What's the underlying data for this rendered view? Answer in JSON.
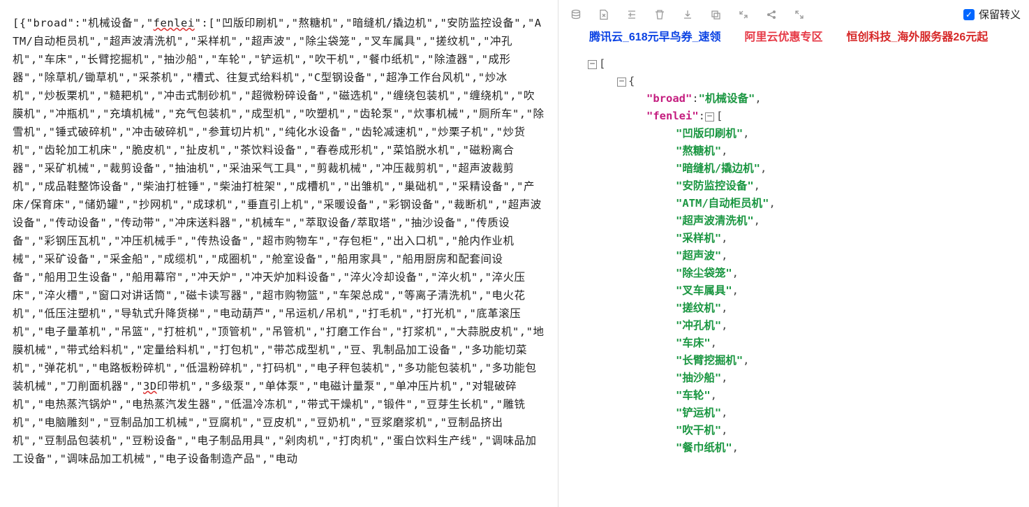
{
  "left_raw": "[{\"broad\":\"机械设备\",\"fenlei\":[\"凹版印刷机\",\"熬糖机\",\"暗缝机/撬边机\",\"安防监控设备\",\"ATM/自动柜员机\",\"超声波清洗机\",\"采样机\",\"超声波\",\"除尘袋笼\",\"叉车属具\",\"搓纹机\",\"冲孔机\",\"车床\",\"长臂挖掘机\",\"抽沙船\",\"车轮\",\"铲运机\",\"吹干机\",\"餐巾纸机\",\"除渣器\",\"成形器\",\"除草机/锄草机\",\"采茶机\",\"槽式、往复式给料机\",\"C型钢设备\",\"超净工作台风机\",\"炒冰机\",\"炒板栗机\",\"糙耙机\",\"冲击式制砂机\",\"超微粉碎设备\",\"磁选机\",\"缠绕包装机\",\"缠绕机\",\"吹膜机\",\"冲瓶机\",\"充填机械\",\"充气包装机\",\"成型机\",\"吹塑机\",\"齿轮泵\",\"炊事机械\",\"厕所车\",\"除雪机\",\"锤式破碎机\",\"冲击破碎机\",\"参茸切片机\",\"纯化水设备\",\"齿轮减速机\",\"炒栗子机\",\"炒货机\",\"齿轮加工机床\",\"脆皮机\",\"扯皮机\",\"茶饮料设备\",\"春卷成形机\",\"菜馅脱水机\",\"磁粉离合器\",\"采矿机械\",\"裁剪设备\",\"抽油机\",\"采油采气工具\",\"剪裁机械\",\"冲压裁剪机\",\"超声波裁剪机\",\"成品鞋整饰设备\",\"柴油打桩锤\",\"柴油打桩架\",\"成槽机\",\"出雏机\",\"巢础机\",\"采精设备\",\"产床/保育床\",\"储奶罐\",\"抄网机\",\"成球机\",\"垂直引上机\",\"采暖设备\",\"彩钢设备\",\"裁断机\",\"超声波设备\",\"传动设备\",\"传动带\",\"冲床送料器\",\"机械车\",\"萃取设备/萃取塔\",\"抽沙设备\",\"传质设备\",\"彩钢压瓦机\",\"冲压机械手\",\"传热设备\",\"超市购物车\",\"存包柜\",\"出入口机\",\"舱内作业机械\",\"采矿设备\",\"采金船\",\"成缆机\",\"成圈机\",\"舱室设备\",\"船用家具\",\"船用厨房和配套间设备\",\"船用卫生设备\",\"船用幕帘\",\"冲天炉\",\"冲天炉加料设备\",\"淬火冷却设备\",\"淬火机\",\"淬火压床\",\"淬火槽\",\"窗口对讲话筒\",\"磁卡读写器\",\"超市购物篮\",\"车架总成\",\"等离子清洗机\",\"电火花机\",\"低压注塑机\",\"导轨式升降货梯\",\"电动葫芦\",\"吊运机/吊机\",\"打毛机\",\"打光机\",\"底革滚压机\",\"电子量革机\",\"吊篮\",\"打桩机\",\"顶管机\",\"吊管机\",\"打磨工作台\",\"打浆机\",\"大蒜脱皮机\",\"地膜机械\",\"带式给料机\",\"定量给料机\",\"打包机\",\"带芯成型机\",\"豆、乳制品加工设备\",\"多功能切菜机\",\"弹花机\",\"电路板粉碎机\",\"低温粉碎机\",\"打码机\",\"电子秤包装机\",\"多功能包装机\",\"多功能包装机械\",\"刀削面机器\",\"3D印带机\",\"多级泵\",\"单体泵\",\"电磁计量泵\",\"单冲压片机\",\"对辊破碎机\",\"电热蒸汽锅炉\",\"电热蒸汽发生器\",\"低温冷冻机\",\"带式干燥机\",\"锻件\",\"豆芽生长机\",\"雕铣机\",\"电脑雕刻\",\"豆制品加工机械\",\"豆腐机\",\"豆皮机\",\"豆奶机\",\"豆浆磨浆机\",\"豆制品挤出机\",\"豆制品包装机\",\"豆粉设备\",\"电子制品用具\",\"剁肉机\",\"打肉机\",\"蛋白饮料生产线\",\"调味品加工设备\",\"调味品加工机械\",\"电子设备制造产品\",\"电动",
  "underline_words": [
    "fenlei",
    "3D"
  ],
  "toolbar": {
    "checkbox_label": "保留转义"
  },
  "ads": {
    "ad1": "腾讯云_618元早鸟券_速领",
    "ad2": "阿里云优惠专区",
    "ad3": "恒创科技_海外服务器26元起"
  },
  "tree": {
    "broad_key": "\"broad\"",
    "broad_val": "\"机械设备\"",
    "fenlei_key": "\"fenlei\"",
    "items": [
      "\"凹版印刷机\"",
      "\"熬糖机\"",
      "\"暗缝机/撬边机\"",
      "\"安防监控设备\"",
      "\"ATM/自动柜员机\"",
      "\"超声波清洗机\"",
      "\"采样机\"",
      "\"超声波\"",
      "\"除尘袋笼\"",
      "\"叉车属具\"",
      "\"搓纹机\"",
      "\"冲孔机\"",
      "\"车床\"",
      "\"长臂挖掘机\"",
      "\"抽沙船\"",
      "\"车轮\"",
      "\"铲运机\"",
      "\"吹干机\"",
      "\"餐巾纸机\""
    ]
  }
}
